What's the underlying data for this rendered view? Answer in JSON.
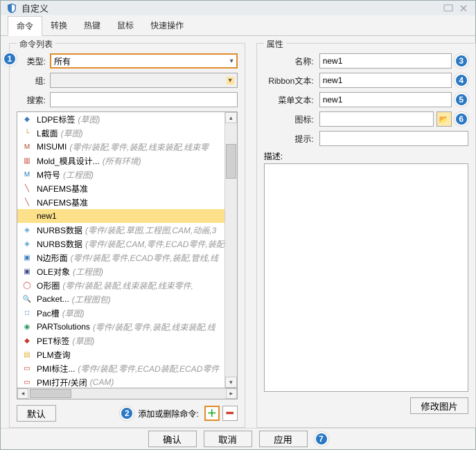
{
  "window": {
    "title": "自定义"
  },
  "tabs": {
    "cmd": "命令",
    "convert": "转换",
    "hotkey": "热键",
    "mouse": "鼠标",
    "quick": "快速操作"
  },
  "left": {
    "title": "命令列表",
    "type_label": "类型:",
    "type_value": "所有",
    "group_label": "组:",
    "group_value": "",
    "search_label": "搜索:",
    "search_value": "",
    "items": [
      {
        "label": "LDPE标签",
        "hint": "(草图)"
      },
      {
        "label": "L截面",
        "hint": "(草图)"
      },
      {
        "label": "MISUMI",
        "hint": "(零件/装配,零件,装配,线束装配,线束零"
      },
      {
        "label": "Mold_模具设计...",
        "hint": "(所有环境)"
      },
      {
        "label": "M符号",
        "hint": "(工程图)"
      },
      {
        "label": "NAFEMS基准",
        "hint": ""
      },
      {
        "label": "NAFEMS基准",
        "hint": ""
      },
      {
        "label": "new1",
        "hint": "",
        "selected": true
      },
      {
        "label": "NURBS数据",
        "hint": "(零件/装配,草图,工程图,CAM,动画,3"
      },
      {
        "label": "NURBS数据",
        "hint": "(零件/装配,CAM,零件,ECAD零件,装配"
      },
      {
        "label": "N边形面",
        "hint": "(零件/装配,零件,ECAD零件,装配,管线,线"
      },
      {
        "label": "OLE对象",
        "hint": "(工程图)"
      },
      {
        "label": "O形圈",
        "hint": "(零件/装配,装配,线束装配,线束零件,"
      },
      {
        "label": "Packet...",
        "hint": "(工程图包)"
      },
      {
        "label": "Pac槽",
        "hint": "(草图)"
      },
      {
        "label": "PARTsolutions",
        "hint": "(零件/装配,零件,装配,线束装配,线"
      },
      {
        "label": "PET标签",
        "hint": "(草图)"
      },
      {
        "label": "PLM查询",
        "hint": ""
      },
      {
        "label": "PMI标注...",
        "hint": "(零件/装配,零件,ECAD装配,ECAD零件"
      },
      {
        "label": "PMI打开/关闭",
        "hint": "(CAM)"
      }
    ],
    "default_btn": "默认",
    "addrem_label": "添加或删除命令:"
  },
  "right": {
    "title": "属性",
    "name_label": "名称:",
    "name_value": "new1",
    "ribbon_label": "Ribbon文本:",
    "ribbon_value": "new1",
    "menu_label": "菜单文本:",
    "menu_value": "new1",
    "icon_label": "图标:",
    "icon_value": "",
    "hint_label": "提示:",
    "hint_value": "",
    "desc_label": "描述:",
    "modify_btn": "修改图片"
  },
  "buttons": {
    "ok": "确认",
    "cancel": "取消",
    "apply": "应用"
  },
  "callouts": {
    "c1": "1",
    "c2": "2",
    "c3": "3",
    "c4": "4",
    "c5": "5",
    "c6": "6",
    "c7": "7"
  }
}
